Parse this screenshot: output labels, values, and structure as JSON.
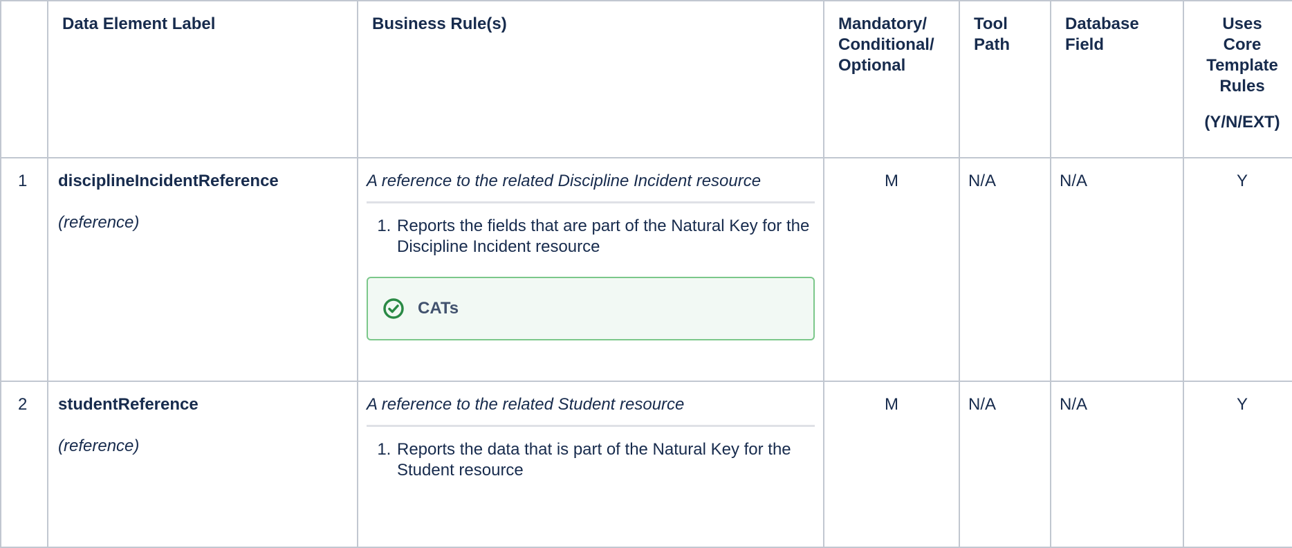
{
  "table": {
    "headers": {
      "num": "",
      "label": "Data Element Label",
      "rules": "Business Rule(s)",
      "mco": [
        "Mandatory/",
        "Conditional/",
        "Optional"
      ],
      "tool": [
        "Tool",
        "Path"
      ],
      "db": [
        "Database",
        "Field"
      ],
      "core": [
        "Uses",
        "Core",
        "Template",
        "Rules"
      ],
      "core_sub": "(Y/N/EXT)"
    },
    "rows": [
      {
        "num": "1",
        "name": "disciplineIncidentReference",
        "type": "(reference)",
        "description": "A reference to the related Discipline Incident resource",
        "rules": [
          "Reports the fields that are part of the Natural Key for the Discipline Incident resource"
        ],
        "panel": {
          "title": "CATs",
          "icon": "check-circle-icon",
          "color": "#2a8a45"
        },
        "mco": "M",
        "tool_path": "N/A",
        "db_field": "N/A",
        "core": "Y"
      },
      {
        "num": "2",
        "name": "studentReference",
        "type": "(reference)",
        "description": "A reference to the related Student resource",
        "rules": [
          "Reports the data that is part of the Natural Key for the Student resource"
        ],
        "mco": "M",
        "tool_path": "N/A",
        "db_field": "N/A",
        "core": "Y"
      }
    ]
  },
  "colors": {
    "border": "#c1c7d0",
    "panel_border": "#7bc78a",
    "panel_bg": "#f2f9f4",
    "text": "#172b4d"
  }
}
